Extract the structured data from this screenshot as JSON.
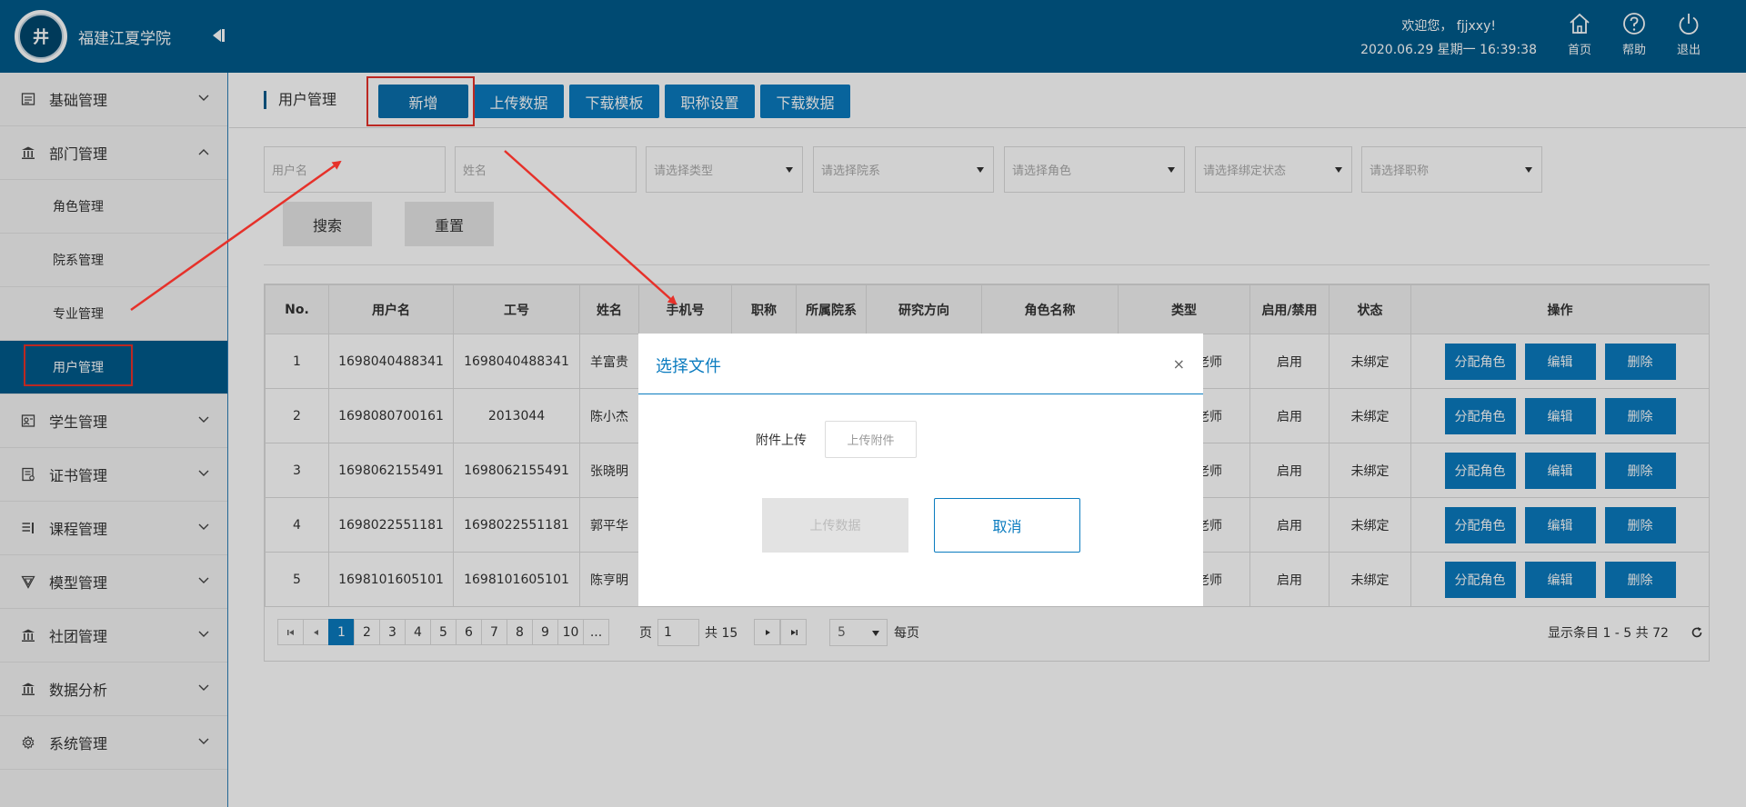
{
  "header": {
    "app_title": "福建江夏学院",
    "logo_char": "井",
    "welcome": "欢迎您，  fjjxxy!",
    "datetime": "2020.06.29 星期一 16:39:38",
    "home_label": "首页",
    "help_label": "帮助",
    "logout_label": "退出"
  },
  "sidebar": {
    "items": [
      {
        "label": "基础管理",
        "icon": "list-icon",
        "expanded": false
      },
      {
        "label": "部门管理",
        "icon": "institution-icon",
        "expanded": true
      },
      {
        "label": "学生管理",
        "icon": "student-icon",
        "expanded": false
      },
      {
        "label": "证书管理",
        "icon": "certificate-icon",
        "expanded": false
      },
      {
        "label": "课程管理",
        "icon": "course-icon",
        "expanded": false
      },
      {
        "label": "模型管理",
        "icon": "model-icon",
        "expanded": false
      },
      {
        "label": "社团管理",
        "icon": "club-icon",
        "expanded": false
      },
      {
        "label": "数据分析",
        "icon": "analysis-icon",
        "expanded": false
      },
      {
        "label": "系统管理",
        "icon": "settings-icon",
        "expanded": false
      }
    ],
    "sub_items": [
      "角色管理",
      "院系管理",
      "专业管理",
      "用户管理"
    ],
    "active_sub": "用户管理"
  },
  "toolbar": {
    "page_label": "用户管理",
    "buttons": [
      "新增",
      "上传数据",
      "下载模板",
      "职称设置",
      "下载数据"
    ]
  },
  "filters": {
    "username_placeholder": "用户名",
    "name_placeholder": "姓名",
    "type_placeholder": "请选择类型",
    "dept_placeholder": "请选择院系",
    "role_placeholder": "请选择角色",
    "bind_placeholder": "请选择绑定状态",
    "title_placeholder": "请选择职称",
    "search_label": "搜索",
    "reset_label": "重置"
  },
  "table": {
    "columns": [
      "No.",
      "用户名",
      "工号",
      "姓名",
      "手机号",
      "职称",
      "所属院系",
      "研究方向",
      "角色名称",
      "类型",
      "启用/禁用",
      "状态",
      "操作"
    ],
    "rows": [
      {
        "no": "1",
        "username": "1698040488341",
        "job_no": "1698040488341",
        "name": "羊富贵",
        "type": "部门负责老师",
        "enabled": "启用",
        "status": "未绑定"
      },
      {
        "no": "2",
        "username": "1698080700161",
        "job_no": "2013044",
        "name": "陈小杰",
        "type": "部门负责老师",
        "enabled": "启用",
        "status": "未绑定"
      },
      {
        "no": "3",
        "username": "1698062155491",
        "job_no": "1698062155491",
        "name": "张晓明",
        "type": "部门负责老师",
        "enabled": "启用",
        "status": "未绑定"
      },
      {
        "no": "4",
        "username": "1698022551181",
        "job_no": "1698022551181",
        "name": "郭平华",
        "type": "部门负责老师",
        "enabled": "启用",
        "status": "未绑定"
      },
      {
        "no": "5",
        "username": "1698101605101",
        "job_no": "1698101605101",
        "name": "陈亨明",
        "type": "部门负责老师",
        "enabled": "启用",
        "status": "未绑定"
      }
    ],
    "op_labels": {
      "assign": "分配角色",
      "edit": "编辑",
      "delete": "删除"
    }
  },
  "pager": {
    "pages": [
      "1",
      "2",
      "3",
      "4",
      "5",
      "6",
      "7",
      "8",
      "9",
      "10",
      "..."
    ],
    "current": "1",
    "page_label": "页",
    "page_input": "1",
    "total_pages": "共 15",
    "page_size": "5",
    "per_page_label": "每页",
    "status": "显示条目 1 - 5 共 72"
  },
  "modal": {
    "title": "选择文件",
    "close_glyph": "×",
    "attach_label": "附件上传",
    "attach_button": "上传附件",
    "upload_button": "上传数据",
    "cancel_button": "取消"
  },
  "colors": {
    "primary": "#005b8c",
    "accent": "#0a7bbf",
    "annotation": "#e6312a"
  }
}
